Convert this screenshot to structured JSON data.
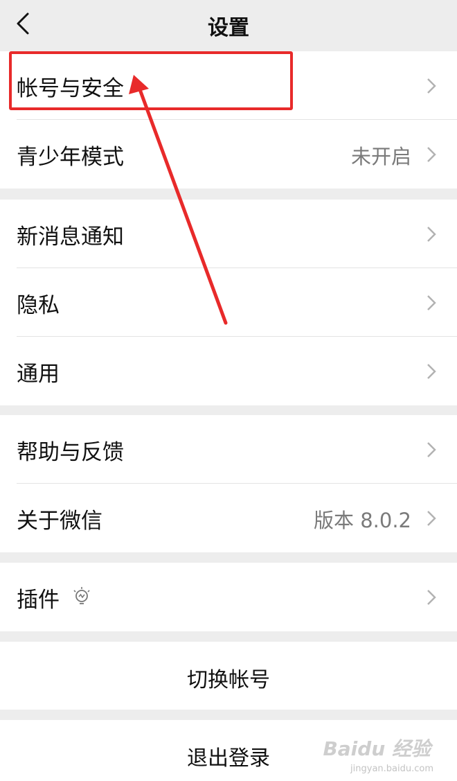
{
  "header": {
    "title": "设置"
  },
  "groups": [
    {
      "rows": [
        {
          "label": "帐号与安全",
          "value": ""
        },
        {
          "label": "青少年模式",
          "value": "未开启"
        }
      ]
    },
    {
      "rows": [
        {
          "label": "新消息通知",
          "value": ""
        },
        {
          "label": "隐私",
          "value": ""
        },
        {
          "label": "通用",
          "value": ""
        }
      ]
    },
    {
      "rows": [
        {
          "label": "帮助与反馈",
          "value": ""
        },
        {
          "label": "关于微信",
          "value": "版本 8.0.2"
        }
      ]
    },
    {
      "rows": [
        {
          "label": "插件",
          "value": "",
          "icon": "lightbulb-icon"
        }
      ]
    }
  ],
  "actions": {
    "switch_account": "切换帐号",
    "logout": "退出登录"
  },
  "annotation": {
    "color": "#e82a2a"
  },
  "watermark": {
    "brand": "Baidu 经验",
    "url": "jingyan.baidu.com"
  },
  "colors": {
    "background": "#ededed",
    "card": "#ffffff",
    "secondary_text": "#7a7a7a"
  }
}
